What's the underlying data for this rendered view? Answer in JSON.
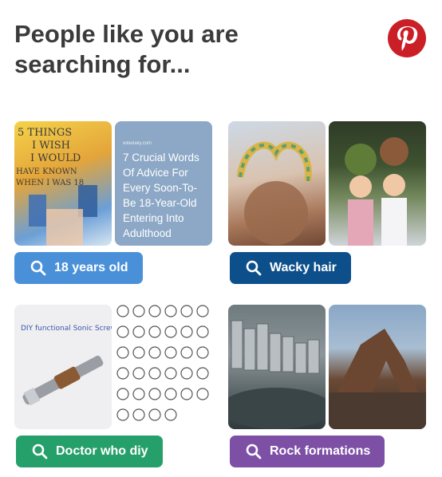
{
  "header": {
    "title": "People like you are searching for...",
    "logo_icon": "pinterest-logo-icon",
    "logo_color": "#cb1f27"
  },
  "cards": [
    {
      "chip_label": "18 years old",
      "chip_color": "#4a90d9",
      "thumb_left": {
        "text_lines": [
          "5 THINGS",
          "I WISH",
          "I WOULD",
          "HAVE KNOWN",
          "WHEN I WAS 18"
        ]
      },
      "thumb_right": {
        "small": "elitedaily.com",
        "text": "7 Crucial Words Of Advice For Every Soon-To-Be 18-Year-Old Entering Into Adulthood"
      }
    },
    {
      "chip_label": "Wacky hair",
      "chip_color": "#0d4f8b"
    },
    {
      "chip_label": "Doctor who diy",
      "chip_color": "#26a06a",
      "thumb_left": {
        "text": "DIY functional Sonic Screwdriver"
      }
    },
    {
      "chip_label": "Rock formations",
      "chip_color": "#7d50a6"
    }
  ]
}
